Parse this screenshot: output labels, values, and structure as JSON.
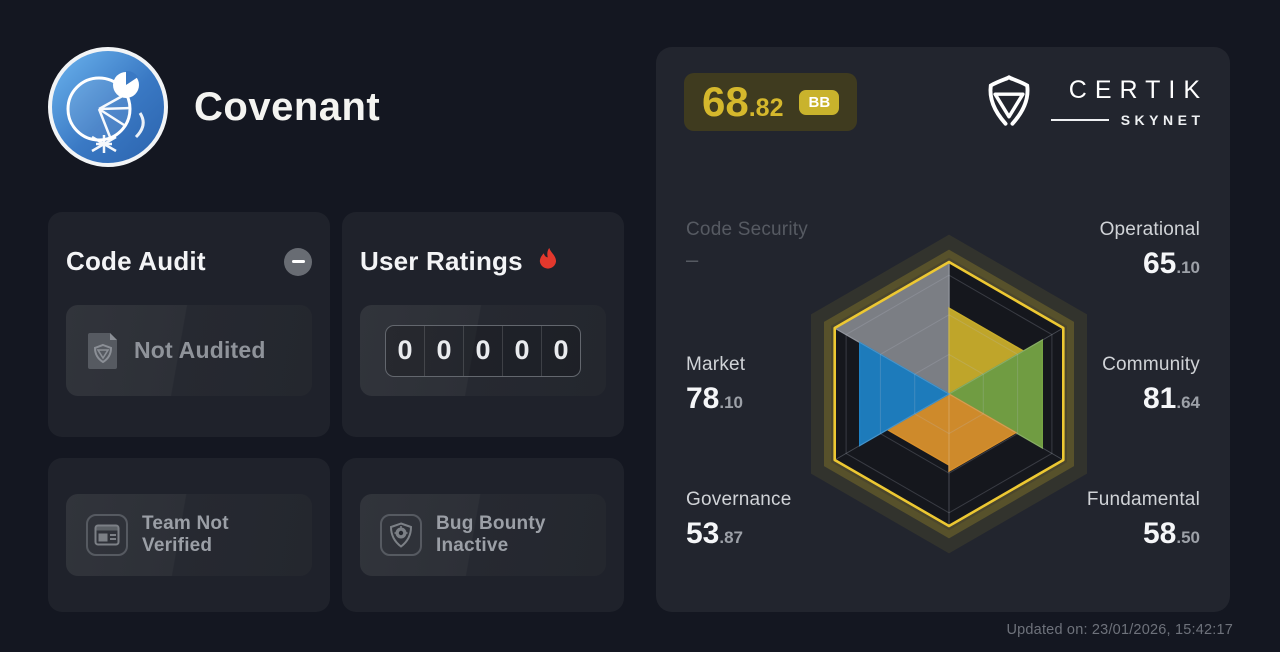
{
  "project": {
    "name": "Covenant"
  },
  "brand": {
    "name": "CERTIK",
    "sub": "SKYNET"
  },
  "score": {
    "int": "68",
    "dec": ".82",
    "full": "68.82",
    "grade": "BB",
    "accent_color": "#d5b82c",
    "badge_color": "#c9b32c"
  },
  "cards": {
    "code_audit": {
      "title": "Code Audit",
      "status": "Not Audited",
      "badge": "minus"
    },
    "user_ratings": {
      "title": "User Ratings",
      "digits": [
        "0",
        "0",
        "0",
        "0",
        "0"
      ]
    },
    "team": {
      "status": "Team Not Verified"
    },
    "bug_bounty": {
      "status": "Bug Bounty Inactive"
    }
  },
  "metrics": [
    {
      "label": "Code Security",
      "int": "–",
      "dec": ""
    },
    {
      "label": "Operational",
      "int": "65",
      "dec": ".10"
    },
    {
      "label": "Market",
      "int": "78",
      "dec": ".10"
    },
    {
      "label": "Community",
      "int": "81",
      "dec": ".64"
    },
    {
      "label": "Governance",
      "int": "53",
      "dec": ".87"
    },
    {
      "label": "Fundamental",
      "int": "58",
      "dec": ".50"
    }
  ],
  "chart_data": {
    "type": "radar-hexagon",
    "categories": [
      "Code Security",
      "Operational",
      "Community",
      "Fundamental",
      "Governance",
      "Market"
    ],
    "values": [
      null,
      65.1,
      81.64,
      58.5,
      53.87,
      78.1
    ],
    "max": 100,
    "wedge_colors": [
      "#81848a",
      "#c8ad2b",
      "#75a344",
      "#d8902c",
      "#d8902c",
      "#1e81c4"
    ],
    "na_color": "#81848a",
    "border_color": "#edc832",
    "glow_color": "#c8ac28",
    "inner_bg": "#15171d",
    "grid_rings": [
      0.3,
      0.6,
      0.9
    ],
    "grid_on": true,
    "legend_position": "around"
  },
  "footer": {
    "updated": "Updated on: 23/01/2026, 15:42:17"
  }
}
